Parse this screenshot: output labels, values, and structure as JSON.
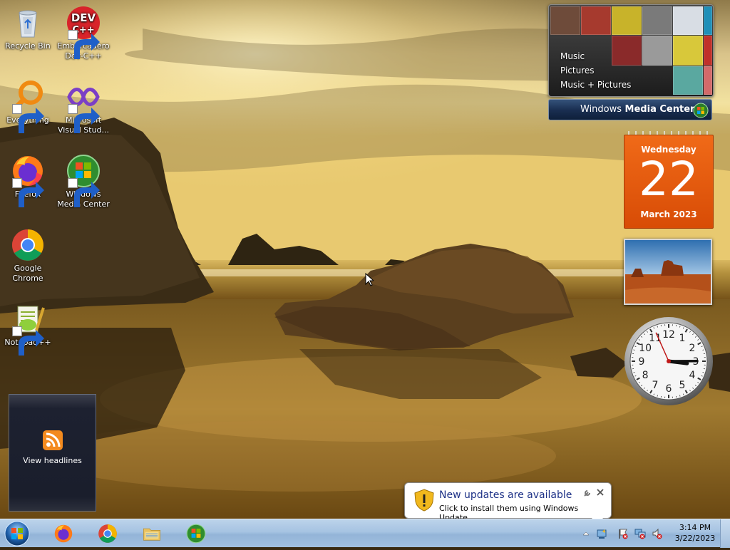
{
  "desktop": {
    "icons": [
      {
        "label": "Recycle Bin"
      },
      {
        "label": "Embarcadero Dev-C++"
      },
      {
        "label": "Everything"
      },
      {
        "label": "Microsoft Visual Stud..."
      },
      {
        "label": "Firefox"
      },
      {
        "label": "Windows Media Center"
      },
      {
        "label": "Google Chrome"
      },
      {
        "label": "Notepad++"
      }
    ],
    "devcpp_logo": {
      "line1": "DEV",
      "line2": "C++"
    }
  },
  "gadgets": {
    "media_center": {
      "menu": [
        "Music",
        "Pictures",
        "Music + Pictures"
      ],
      "brand_regular": "Windows",
      "brand_bold": " Media Center"
    },
    "calendar": {
      "weekday": "Wednesday",
      "day": "22",
      "month_year": "March 2023",
      "color": "#e85a10"
    },
    "clock": {
      "hour": 3,
      "minute": 14,
      "second": 56,
      "numerals": [
        "12",
        "1",
        "2",
        "3",
        "4",
        "5",
        "6",
        "7",
        "8",
        "9",
        "10",
        "11"
      ]
    },
    "feed": {
      "label": "View headlines"
    }
  },
  "notification": {
    "title": "New updates are available",
    "body": "Click to install them using Windows Update."
  },
  "taskbar": {
    "pinned": [
      "start-orb",
      "firefox",
      "chrome",
      "file-explorer",
      "windows-media-center"
    ],
    "tray": {
      "time": "3:14 PM",
      "date": "3/22/2023"
    }
  }
}
